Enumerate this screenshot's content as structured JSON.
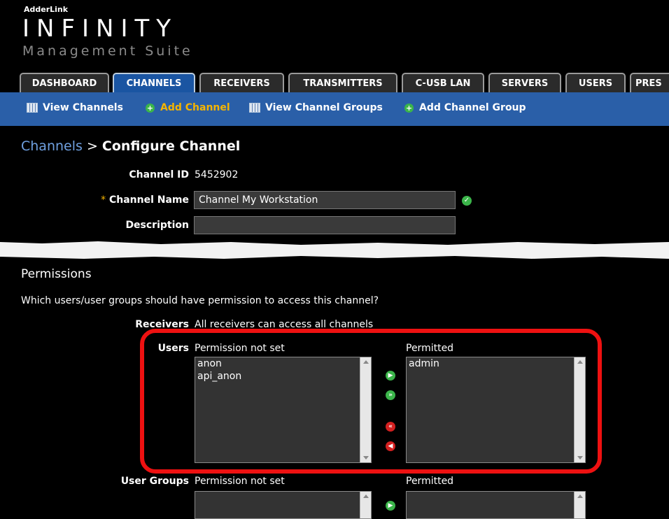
{
  "header": {
    "brand_small": "AdderLink",
    "brand_big": "INFINITY",
    "brand_sub": "Management Suite"
  },
  "tabs": [
    {
      "label": "DASHBOARD"
    },
    {
      "label": "CHANNELS",
      "active": true
    },
    {
      "label": "RECEIVERS"
    },
    {
      "label": "TRANSMITTERS"
    },
    {
      "label": "C-USB LAN"
    },
    {
      "label": "SERVERS"
    },
    {
      "label": "USERS"
    },
    {
      "label": "PRES"
    }
  ],
  "subnav": {
    "view_channels": "View Channels",
    "add_channel": "Add Channel",
    "view_channel_groups": "View Channel Groups",
    "add_channel_group": "Add Channel Group"
  },
  "breadcrumb": {
    "parent": "Channels",
    "separator": " > ",
    "current": "Configure Channel"
  },
  "form": {
    "channel_id_label": "Channel ID",
    "channel_id_value": "5452902",
    "required_mark": "*",
    "channel_name_label": "Channel Name",
    "channel_name_value": "Channel My Workstation",
    "description_label": "Description",
    "description_value": ""
  },
  "permissions": {
    "heading": "Permissions",
    "question": "Which users/user groups should have permission to access this channel?",
    "receivers_label": "Receivers",
    "receivers_value": "All receivers can access all channels",
    "users_label": "Users",
    "not_set_header": "Permission not set",
    "permitted_header": "Permitted",
    "users_not_set": [
      "anon",
      "api_anon"
    ],
    "users_permitted": [
      "admin"
    ],
    "user_groups_label": "User Groups",
    "groups_not_set_header": "Permission not set",
    "groups_permitted_header": "Permitted"
  },
  "colors": {
    "subnav_bg": "#2a5fa8",
    "active_tab": "#1a55a2",
    "highlight": "#ee1111",
    "link": "#6fa0e0",
    "current_subnav": "#f5b400"
  }
}
